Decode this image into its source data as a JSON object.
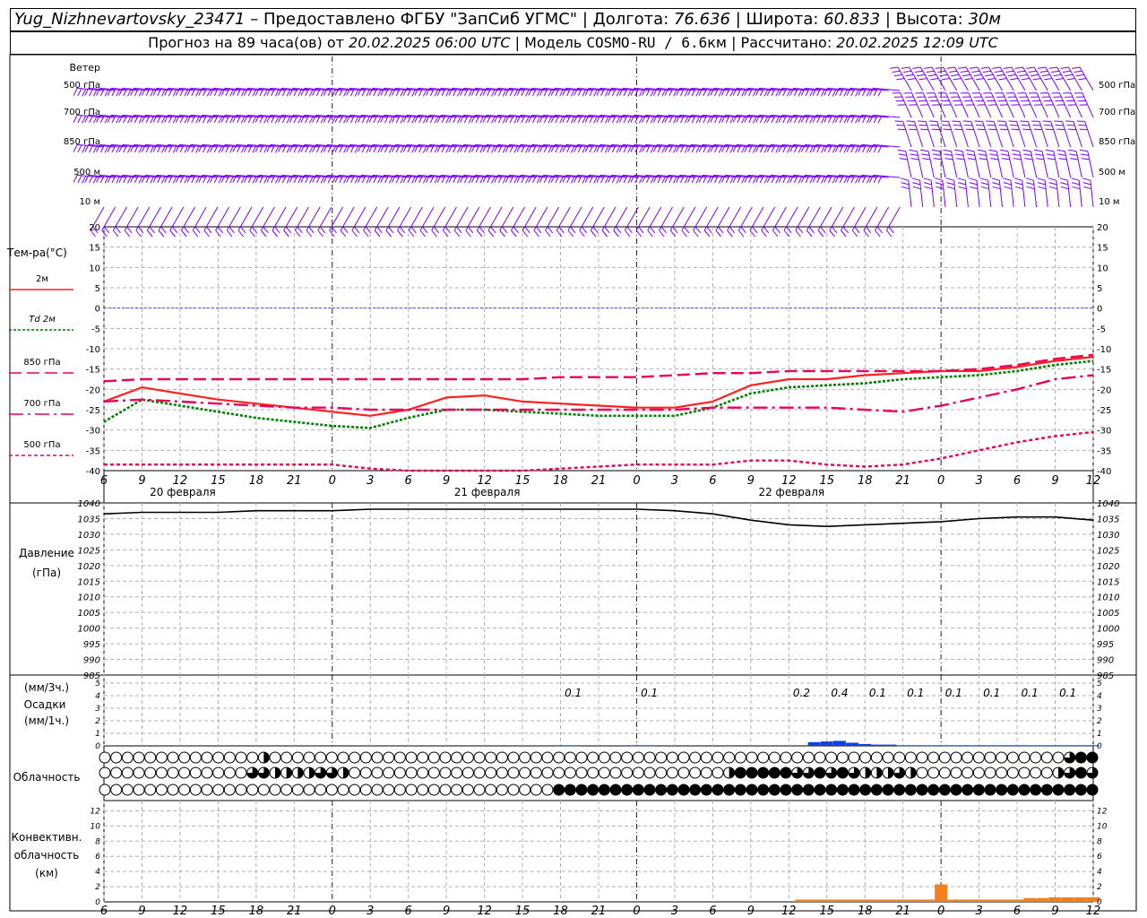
{
  "header": {
    "station": "Yug_Nizhnevartovsky_23471",
    "dash": " – ",
    "provided": "Предоставлено ФГБУ \"ЗапСиб УГМС\"",
    "sep": " | ",
    "lon_label": "Долгота: ",
    "lon_value": "76.636",
    "lat_label": "Широта: ",
    "lat_value": "60.833",
    "alt_label": "Высота: ",
    "alt_value": "30м",
    "forecast_pre": "Прогноз на 89 часа(ов) от ",
    "forecast_time": "20.02.2025 06:00 UTC",
    "model_label": " | Модель ",
    "model_name": "COSMO-RU / 6.6",
    "model_unit": "км",
    "calc_label": " | Рассчитано: ",
    "calc_time": "20.02.2025 12:09 UTC"
  },
  "labels": {
    "wind": "Ветер",
    "levels": [
      "500 гПа",
      "700 гПа",
      "850 гПа",
      "500 м",
      "10  м"
    ],
    "temp_title": "Тем-ра(°C)",
    "legend": [
      {
        "text": "2м",
        "color": "#ff2020",
        "dash": "solid"
      },
      {
        "text": "Td  2м",
        "color": "#008000",
        "dash": "dot"
      },
      {
        "text": "850 гПа",
        "color": "#e8005a",
        "dash": "dash"
      },
      {
        "text": "700 гПа",
        "color": "#e8005a",
        "dash": "dashdot"
      },
      {
        "text": "500 гПа",
        "color": "#e8005a",
        "dash": "shortdash"
      }
    ],
    "pressure": [
      "Давление",
      "(гПа)"
    ],
    "precip": [
      "(мм/3ч.)",
      "Осадки",
      "(мм/1ч.)"
    ],
    "cloud": "Облачность",
    "conv": [
      "Конвективн.",
      "облачность",
      "(км)"
    ],
    "days": [
      "20 февраля",
      "21 февраля",
      "22 февраля"
    ],
    "hours": [
      "6",
      "9",
      "12",
      "15",
      "18",
      "21",
      "0",
      "3",
      "6",
      "9",
      "12",
      "15",
      "18",
      "21",
      "0",
      "3",
      "6",
      "9",
      "12",
      "15",
      "18",
      "21",
      "0",
      "3",
      "6",
      "9",
      "12"
    ]
  },
  "colors": {
    "wind": "#7a00ff",
    "t2m": "#ff2020",
    "td2m": "#008000",
    "levels": "#e8005a",
    "zero_line": "#3355ff",
    "precip": "#1040e0",
    "conv": "#f08020"
  },
  "chart_data": [
    {
      "type": "line",
      "title": "Тем-ра(°C)",
      "x": [
        0,
        3,
        6,
        9,
        12,
        15,
        18,
        21,
        24,
        27,
        30,
        33,
        36,
        39,
        42,
        45,
        48,
        51,
        54,
        57,
        60,
        63,
        66,
        69,
        72,
        75,
        78
      ],
      "ylim": [
        -40,
        20
      ],
      "yticks": [
        20,
        15,
        10,
        5,
        0,
        -5,
        -10,
        -15,
        -20,
        -25,
        -30,
        -35,
        -40
      ],
      "series": [
        {
          "name": "2м",
          "values": [
            -23,
            -19.5,
            -21,
            -22.5,
            -23.5,
            -24.5,
            -25.5,
            -26.5,
            -25,
            -22,
            -21.5,
            -23,
            -23.5,
            -24,
            -24.5,
            -24.5,
            -23,
            -19,
            -17.5,
            -17.5,
            -16.5,
            -16,
            -15.5,
            -15.5,
            -14.5,
            -13,
            -12
          ]
        },
        {
          "name": "Td  2м",
          "values": [
            -28,
            -22.5,
            -24,
            -25.5,
            -27,
            -28,
            -29,
            -29.5,
            -27,
            -25,
            -25,
            -25.5,
            -26,
            -26.5,
            -26.5,
            -26.5,
            -24.5,
            -21,
            -19.5,
            -19,
            -18.5,
            -17.5,
            -17,
            -16.5,
            -15.5,
            -14,
            -13
          ]
        },
        {
          "name": "850 гПа",
          "values": [
            -18,
            -17.5,
            -17.5,
            -17.5,
            -17.5,
            -17.5,
            -17.5,
            -17.5,
            -17.5,
            -17.5,
            -17.5,
            -17.5,
            -17,
            -17,
            -17,
            -16.5,
            -16,
            -16,
            -15.5,
            -15.5,
            -15.5,
            -15.5,
            -15.5,
            -15,
            -14,
            -12.5,
            -11.5
          ]
        },
        {
          "name": "700 гПа",
          "values": [
            -23,
            -22.5,
            -23,
            -23.5,
            -24,
            -24.5,
            -24.5,
            -25,
            -25,
            -25,
            -25,
            -25,
            -25,
            -25,
            -25,
            -25,
            -24.5,
            -24.5,
            -24.5,
            -24.5,
            -25,
            -25.5,
            -24,
            -22,
            -20,
            -17.5,
            -16.5
          ]
        },
        {
          "name": "500 гПа",
          "values": [
            -38.5,
            -38.5,
            -38.5,
            -38.5,
            -38.5,
            -38.5,
            -38.5,
            -39.5,
            -40,
            -40,
            -40,
            -40,
            -39.5,
            -39,
            -38.5,
            -38.5,
            -38.5,
            -37.5,
            -37.5,
            -38.5,
            -39,
            -38.5,
            -37,
            -35,
            -33,
            -31.5,
            -30.5
          ]
        }
      ]
    },
    {
      "type": "line",
      "title": "Давление",
      "x": [
        0,
        3,
        6,
        9,
        12,
        15,
        18,
        21,
        24,
        27,
        30,
        33,
        36,
        39,
        42,
        45,
        48,
        51,
        54,
        57,
        60,
        63,
        66,
        69,
        72,
        75,
        78
      ],
      "ylim": [
        985,
        1040
      ],
      "yticks": [
        1040,
        1035,
        1030,
        1025,
        1020,
        1015,
        1010,
        1005,
        1000,
        995,
        990,
        985
      ],
      "series": [
        {
          "name": "",
          "values": [
            1036.5,
            1037,
            1037,
            1037,
            1037.5,
            1037.5,
            1037.5,
            1038,
            1038,
            1038,
            1038,
            1038,
            1038,
            1038,
            1038,
            1037.5,
            1036.5,
            1034.5,
            1033,
            1032.5,
            1033,
            1033.5,
            1034,
            1035,
            1035.5,
            1035.5,
            1034.5
          ]
        }
      ]
    },
    {
      "type": "bar",
      "title": "Осадки",
      "ylim": [
        0,
        5
      ],
      "yticks": [
        5,
        4,
        3,
        2,
        1,
        0
      ],
      "labels": [
        {
          "x": 37,
          "text": "0.1"
        },
        {
          "x": 43,
          "text": "0.1"
        },
        {
          "x": 55,
          "text": "0.2"
        },
        {
          "x": 58,
          "text": "0.4"
        },
        {
          "x": 61,
          "text": "0.1"
        },
        {
          "x": 64,
          "text": "0.1"
        },
        {
          "x": 67,
          "text": "0.1"
        },
        {
          "x": 70,
          "text": "0.1"
        },
        {
          "x": 73,
          "text": "0.1"
        },
        {
          "x": 76,
          "text": "0.1"
        }
      ],
      "hourly_x": [
        36,
        37,
        42,
        43,
        56,
        57,
        58,
        59,
        60,
        61,
        62,
        63,
        64,
        65,
        66,
        67,
        68,
        69,
        70,
        71,
        72,
        73,
        74,
        75,
        76,
        77,
        78
      ],
      "hourly_values": [
        0.05,
        0.05,
        0.05,
        0.05,
        0.3,
        0.35,
        0.4,
        0.25,
        0.15,
        0.1,
        0.1,
        0.05,
        0.05,
        0.05,
        0.05,
        0.05,
        0.05,
        0.05,
        0.05,
        0.05,
        0.05,
        0.05,
        0.05,
        0.05,
        0.05,
        0.05,
        0.05
      ]
    },
    {
      "type": "table",
      "title": "Облачность",
      "rows": [
        {
          "name": "high",
          "values": [
            0,
            0,
            0,
            0,
            0,
            0,
            0,
            0,
            0,
            0,
            0,
            0,
            0,
            0,
            2,
            0,
            0,
            0,
            0,
            0,
            0,
            0,
            0,
            0,
            0,
            0,
            0,
            0,
            0,
            0,
            0,
            0,
            0,
            0,
            0,
            0,
            0,
            0,
            0,
            0,
            0,
            0,
            0,
            0,
            0,
            0,
            0,
            0,
            0,
            0,
            0,
            0,
            0,
            0,
            0,
            0,
            0,
            0,
            0,
            0,
            0,
            0,
            0,
            0,
            0,
            0,
            0,
            0,
            0,
            0,
            0,
            0,
            0,
            0,
            0,
            0,
            0,
            0,
            0,
            0,
            0,
            0,
            0,
            0,
            0,
            3,
            4,
            4
          ]
        },
        {
          "name": "mid",
          "values": [
            0,
            0,
            0,
            0,
            0,
            0,
            0,
            0,
            0,
            0,
            0,
            0,
            0,
            3,
            3,
            2,
            2,
            2,
            2,
            3,
            3,
            2,
            0,
            0,
            0,
            0,
            0,
            0,
            0,
            0,
            0,
            0,
            0,
            0,
            0,
            0,
            0,
            0,
            0,
            0,
            0,
            0,
            0,
            0,
            0,
            0,
            0,
            0,
            0,
            0,
            0,
            0,
            0,
            0,
            0,
            2,
            4,
            4,
            4,
            4,
            4,
            3,
            3,
            4,
            3,
            4,
            3,
            2,
            2,
            2,
            3,
            2,
            0,
            0,
            0,
            0,
            0,
            0,
            0,
            0,
            0,
            0,
            0,
            0,
            2,
            3,
            4,
            3
          ]
        },
        {
          "name": "low",
          "values": [
            0,
            0,
            0,
            0,
            0,
            0,
            0,
            0,
            0,
            0,
            0,
            0,
            0,
            0,
            0,
            0,
            0,
            0,
            0,
            0,
            0,
            0,
            0,
            0,
            0,
            0,
            0,
            0,
            0,
            0,
            0,
            0,
            0,
            0,
            0,
            0,
            0,
            0,
            0,
            0,
            4,
            4,
            4,
            4,
            4,
            4,
            4,
            4,
            4,
            4,
            4,
            4,
            4,
            4,
            4,
            4,
            4,
            4,
            4,
            4,
            4,
            4,
            4,
            4,
            4,
            4,
            4,
            4,
            4,
            4,
            4,
            4,
            4,
            4,
            4,
            4,
            4,
            4,
            4,
            4,
            4,
            4,
            4,
            4,
            4,
            4,
            4,
            4
          ]
        }
      ]
    },
    {
      "type": "bar",
      "title": "Конвективн. облачность",
      "ylim": [
        0,
        13
      ],
      "yticks": [
        12,
        10,
        8,
        6,
        4,
        2,
        0
      ],
      "x": [
        55,
        56,
        57,
        58,
        59,
        60,
        61,
        62,
        63,
        64,
        65,
        66,
        67,
        68,
        69,
        70,
        71,
        72,
        73,
        74,
        75,
        76,
        77,
        78
      ],
      "values": [
        0.3,
        0.3,
        0.3,
        0.3,
        0.3,
        0.3,
        0.3,
        0.3,
        0.3,
        0.3,
        0.3,
        2.3,
        0.3,
        0.3,
        0.3,
        0.3,
        0.3,
        0.3,
        0.5,
        0.5,
        0.6,
        0.6,
        0.6,
        0.6
      ]
    }
  ]
}
